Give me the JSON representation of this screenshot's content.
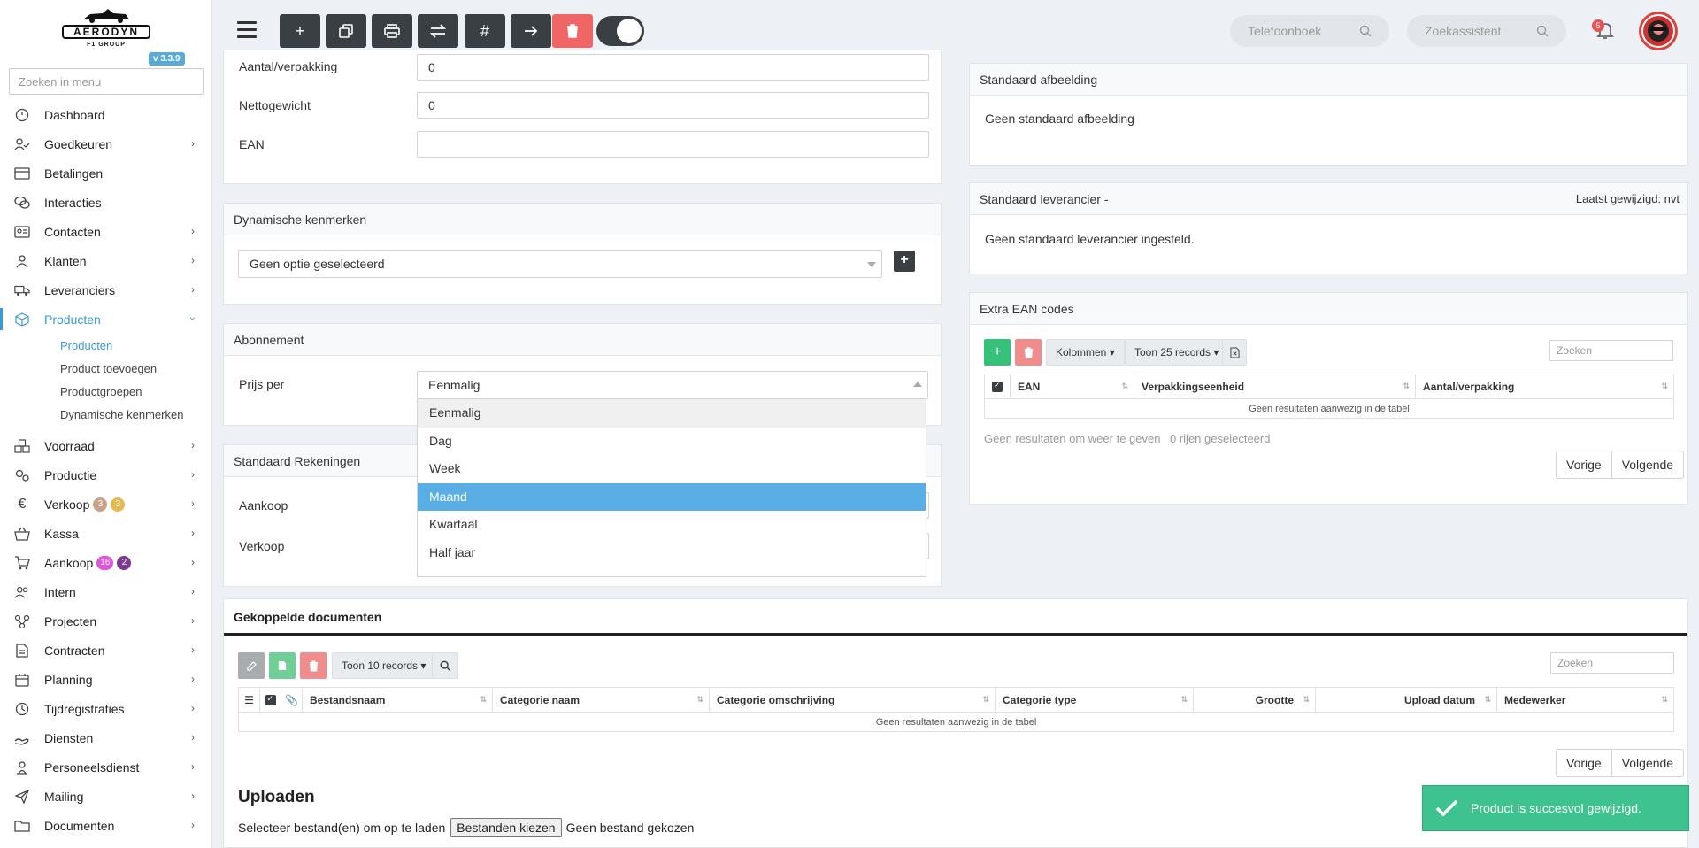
{
  "sidebar": {
    "version": "v 3.3.9",
    "logo_text": "AERODYN",
    "logo_sub": "F1 GROUP",
    "search_placeholder": "Zoeken in menu",
    "items": [
      {
        "label": "Dashboard",
        "icon": "dashboard-icon"
      },
      {
        "label": "Goedkeuren",
        "icon": "approve-icon"
      },
      {
        "label": "Betalingen",
        "icon": "payments-icon"
      },
      {
        "label": "Interacties",
        "icon": "chat-icon"
      },
      {
        "label": "Contacten",
        "icon": "contacts-icon"
      },
      {
        "label": "Klanten",
        "icon": "customer-icon"
      },
      {
        "label": "Leveranciers",
        "icon": "truck-icon"
      },
      {
        "label": "Producten",
        "icon": "box-icon"
      }
    ],
    "sub_items": [
      "Producten",
      "Product toevoegen",
      "Productgroepen",
      "Dynamische kenmerken"
    ],
    "items2": [
      {
        "label": "Voorraad",
        "icon": "stock-icon"
      },
      {
        "label": "Productie",
        "icon": "gears-icon"
      },
      {
        "label": "Verkoop",
        "icon": "euro-icon",
        "badges": [
          "3",
          "3"
        ]
      },
      {
        "label": "Kassa",
        "icon": "basket-icon"
      },
      {
        "label": "Aankoop",
        "icon": "cart-icon",
        "badges": [
          "16",
          "2"
        ]
      },
      {
        "label": "Intern",
        "icon": "users-icon"
      },
      {
        "label": "Projecten",
        "icon": "project-icon"
      },
      {
        "label": "Contracten",
        "icon": "contract-icon"
      },
      {
        "label": "Planning",
        "icon": "calendar-icon"
      },
      {
        "label": "Tijdregistraties",
        "icon": "clock-icon"
      },
      {
        "label": "Diensten",
        "icon": "service-icon"
      },
      {
        "label": "Personeelsdienst",
        "icon": "personnel-icon"
      },
      {
        "label": "Mailing",
        "icon": "send-icon"
      },
      {
        "label": "Documenten",
        "icon": "folder-icon"
      }
    ]
  },
  "topbar": {
    "phonebook_placeholder": "Telefoonboek",
    "assistant_placeholder": "Zoekassistent",
    "notification_count": "5"
  },
  "product": {
    "aantal_label": "Aantal/verpakking",
    "aantal_value": "0",
    "netto_label": "Nettogewicht",
    "netto_value": "0",
    "ean_label": "EAN",
    "ean_value": ""
  },
  "dynamic": {
    "title": "Dynamische kenmerken",
    "select_value": "Geen optie geselecteerd"
  },
  "subscription": {
    "title": "Abonnement",
    "label": "Prijs per",
    "value": "Eenmalig",
    "options": [
      "Eenmalig",
      "Dag",
      "Week",
      "Maand",
      "Kwartaal",
      "Half jaar"
    ]
  },
  "accounts": {
    "title": "Standaard Rekeningen",
    "aankoop": "Aankoop",
    "verkoop": "Verkoop"
  },
  "image_card": {
    "title": "Standaard afbeelding",
    "text": "Geen standaard afbeelding"
  },
  "supplier_card": {
    "title": "Standaard leverancier -",
    "last_modified": "Laatst gewijzigd: nvt",
    "text": "Geen standaard leverancier ingesteld."
  },
  "ean_card": {
    "title": "Extra EAN codes",
    "columns_btn": "Kolommen",
    "records_btn": "Toon 25 records",
    "search_placeholder": "Zoeken",
    "headers": [
      "EAN",
      "Verpakkingseenheid",
      "Aantal/verpakking"
    ],
    "empty": "Geen resultaten aanwezig in de tabel",
    "info": "Geen resultaten om weer te geven",
    "selected": "0 rijen geselecteerd",
    "prev": "Vorige",
    "next": "Volgende"
  },
  "docs_card": {
    "title": "Gekoppelde documenten",
    "records_btn": "Toon 10 records",
    "search_placeholder": "Zoeken",
    "headers": [
      "Bestandsnaam",
      "Categorie naam",
      "Categorie omschrijving",
      "Categorie type",
      "Grootte",
      "Upload datum",
      "Medewerker"
    ],
    "empty": "Geen resultaten aanwezig in de tabel",
    "prev": "Vorige",
    "next": "Volgende",
    "upload_title": "Uploaden",
    "upload_text": "Selecteer bestand(en) om op te laden",
    "choose_btn": "Bestanden kiezen",
    "no_file": "Geen bestand gekozen"
  },
  "toast": {
    "message": "Product is succesvol gewijzigd."
  },
  "colors": {
    "accent": "#3a9ad9",
    "success": "#3ec28f",
    "danger": "#f06565",
    "dark": "#3a3f44"
  }
}
